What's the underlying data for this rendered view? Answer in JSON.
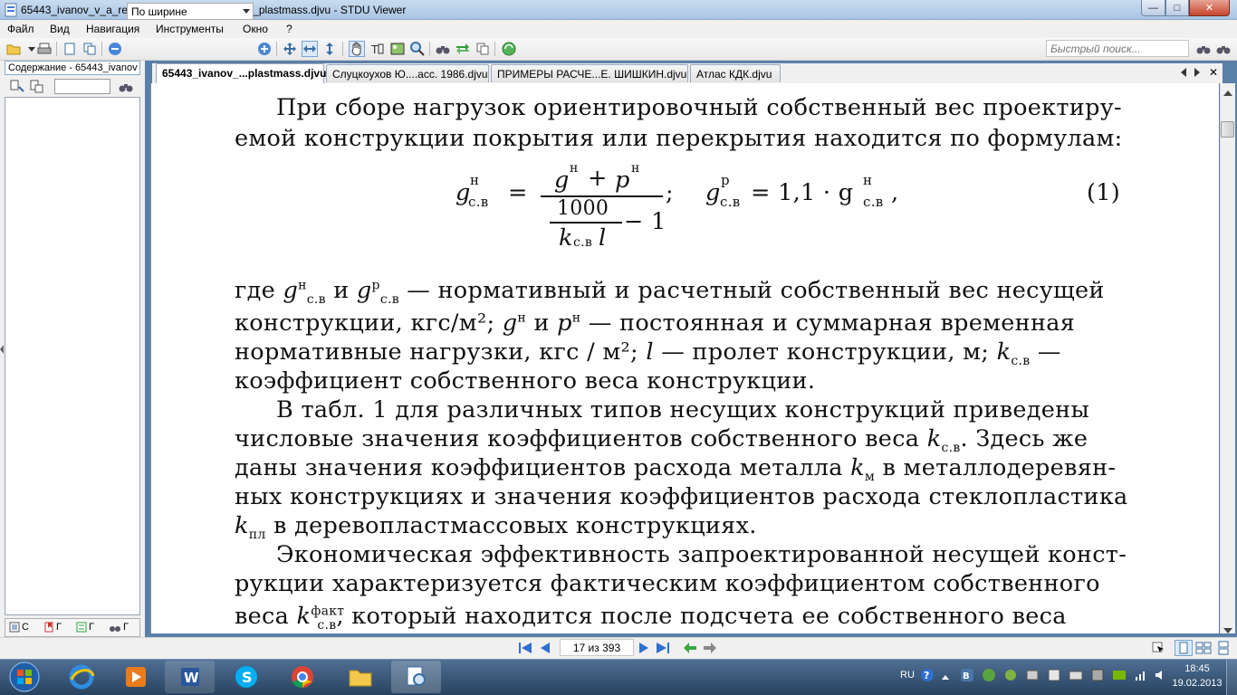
{
  "window": {
    "title": "65443_ivanov_v_a_red_konstrukcii_iz_dereva_i_plastmass.djvu - STDU Viewer",
    "minimize": "—",
    "maximize": "□",
    "close": "✕"
  },
  "menu": [
    "Файл",
    "Вид",
    "Навигация",
    "Инструменты",
    "Окно",
    "?"
  ],
  "toolbar": {
    "zoom_value": "По ширине",
    "search_placeholder": "Быстрый поиск..."
  },
  "sidebar": {
    "title": "Содержание - 65443_ivanov",
    "tabs": [
      "С",
      "Г",
      "Г",
      "Г"
    ]
  },
  "tabs": [
    {
      "label": "65443_ivanov_...plastmass.djvu",
      "active": true
    },
    {
      "label": "Слуцкоухов Ю....асс. 1986.djvu",
      "active": false
    },
    {
      "label": "ПРИМЕРЫ РАСЧЕ...Е. ШИШКИН.djvu",
      "active": false
    },
    {
      "label": "Атлас КДК.djvu",
      "active": false
    }
  ],
  "document": {
    "line1": "При сборе нагрузок ориентировочный собственный вес проектиру-",
    "line2": "емой конструкции покрытия или перекрытия находится по формулам:",
    "formula_g": "g",
    "formula_sup_n": "н",
    "formula_sub_cv": "с.в",
    "formula_eq": "=",
    "formula_num": "gн + pн",
    "formula_num_g": "g",
    "formula_num_sup1": "н",
    "formula_plus": "+",
    "formula_num_p": "p",
    "formula_num_sup2": "н",
    "formula_1000": "1000",
    "formula_minus1": "− 1",
    "formula_k": "k",
    "formula_k_sub": "с.в",
    "formula_l": "l",
    "formula_semicolon": ";",
    "formula_gp": "g",
    "formula_gp_sup": "р",
    "formula_gp_sub": "с.в",
    "formula_rhs": "= 1,1 · g",
    "formula_rhs_sup": "н",
    "formula_rhs_sub": "с.в",
    "formula_comma": ",",
    "formula_number": "(1)",
    "p1_a": "где",
    "p1_b": "и",
    "p1_c": "— нормативный и расчетный собственный вес несущей",
    "p2": "конструкции, кгс/м²;",
    "p2_b": "и",
    "p2_c": "— постоянная и суммарная временная",
    "p3": "нормативные нагрузки, кгс / м²;",
    "p3_b": "— пролет конструкции, м;",
    "p3_c": "—",
    "p4": "коэффициент собственного веса конструкции.",
    "p5": "В табл. 1 для различных типов несущих конструкций приведены",
    "p6": "числовые значения коэффициентов собственного веса",
    "p6_b": ". Здесь же",
    "p7": "даны значения коэффициентов расхода металла",
    "p7_b": "в металлодеревян-",
    "p8": "ных конструкциях и значения коэффициентов расхода стеклопластика",
    "p9_b": "в деревопластмассовых конструкциях.",
    "p10": "Экономическая эффективность запроектированной несущей конст-",
    "p11": "рукции характеризуется фактическим коэффициентом собственного",
    "p12": "веса",
    "p12_sup": "факт",
    "p12_b": ", который находится после подсчета ее собственного веса",
    "k": "k",
    "sub_cv": "с.в",
    "sub_m": "м",
    "sub_pl": "пл",
    "sup_n": "н",
    "sup_p": "р",
    "g": "g",
    "p": "p",
    "l": "l"
  },
  "navigation": {
    "page_indicator": "17 из 393"
  },
  "taskbar": {
    "lang": "RU",
    "time": "18:45",
    "date": "19.02.2013"
  }
}
